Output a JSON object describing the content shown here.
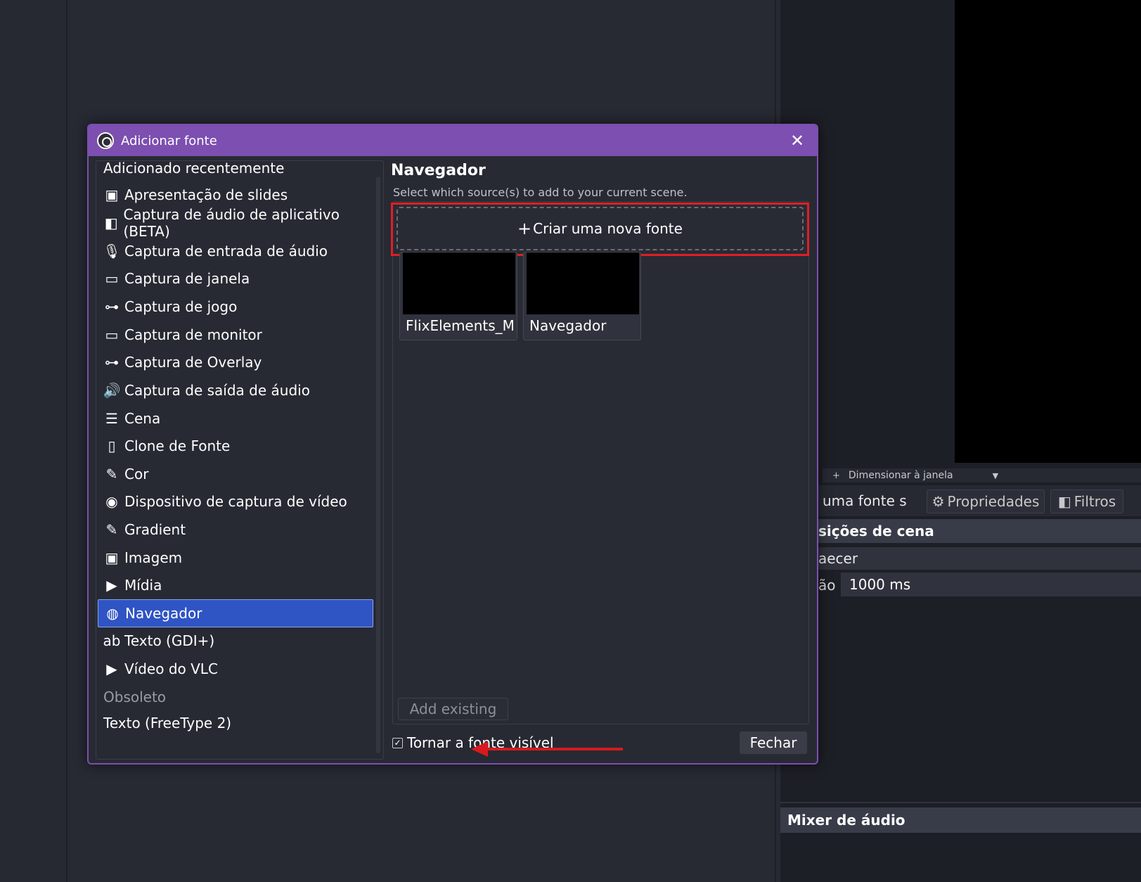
{
  "dialog": {
    "title": "Adicionar fonte",
    "close_label": "✕"
  },
  "source_types": [
    {
      "label": "Adicionado recentemente",
      "icon": "none"
    },
    {
      "label": "Apresentação de slides",
      "icon": "slideshow-icon"
    },
    {
      "label": "Captura de áudio de aplicativo (BETA)",
      "icon": "app-audio-icon"
    },
    {
      "label": "Captura de entrada de áudio",
      "icon": "microphone-icon"
    },
    {
      "label": "Captura de janela",
      "icon": "window-icon"
    },
    {
      "label": "Captura de jogo",
      "icon": "gamepad-icon"
    },
    {
      "label": "Captura de monitor",
      "icon": "monitor-icon"
    },
    {
      "label": "Captura de Overlay",
      "icon": "gamepad-icon"
    },
    {
      "label": "Captura de saída de áudio",
      "icon": "speaker-icon"
    },
    {
      "label": "Cena",
      "icon": "list-icon"
    },
    {
      "label": "Clone de Fonte",
      "icon": "file-icon"
    },
    {
      "label": "Cor",
      "icon": "brush-icon"
    },
    {
      "label": "Dispositivo de captura de vídeo",
      "icon": "camera-icon"
    },
    {
      "label": "Gradient",
      "icon": "brush-icon"
    },
    {
      "label": "Imagem",
      "icon": "image-icon"
    },
    {
      "label": "Mídia",
      "icon": "play-icon"
    },
    {
      "label": "Navegador",
      "icon": "globe-icon",
      "selected": true
    },
    {
      "label": "Texto (GDI+)",
      "icon": "text-icon"
    },
    {
      "label": "Vídeo do VLC",
      "icon": "play-icon"
    },
    {
      "label": "Obsoleto",
      "icon": "none"
    },
    {
      "label": "Texto (FreeType 2)",
      "icon": "none"
    }
  ],
  "panel": {
    "title": "Navegador",
    "subtitle": "Select which source(s) to add to your current scene.",
    "create_new_label": "Criar uma nova fonte",
    "existing": [
      {
        "label": "FlixElements_MC"
      },
      {
        "label": "Navegador"
      }
    ],
    "add_existing_label": "Add existing",
    "visible_label": "Tornar a fonte visível",
    "visible_checked": true,
    "close_button_label": "Fechar"
  },
  "background": {
    "scale_label": "Dimensionar à janela",
    "no_source_text": "uma fonte s",
    "properties_label": "Propriedades",
    "filters_label": "Filtros",
    "transitions_header": "sições de cena",
    "transition_value": "aecer",
    "duration_label": "ão",
    "duration_value": "1000 ms",
    "audio_mixer_header": "Mixer de áudio"
  },
  "colors": {
    "accent": "#7c4fb0",
    "selected": "#2f54c4",
    "annotation": "#e01e24"
  }
}
